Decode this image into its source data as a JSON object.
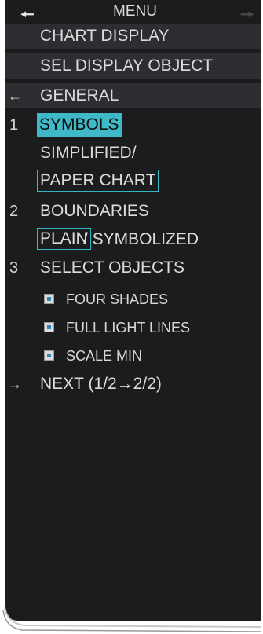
{
  "menu": {
    "title": "MENU",
    "back_icon": "left-arrow-icon",
    "forward_icon": "right-arrow-icon"
  },
  "submenus": {
    "chart_display": "CHART DISPLAY",
    "sel_display_object": "SEL DISPLAY OBJECT"
  },
  "back_row": {
    "icon": "left-arrow-icon",
    "label": "GENERAL"
  },
  "items": {
    "symbols": {
      "number": "1",
      "label": "SYMBOLS",
      "options": [
        "SIMPLIFIED/",
        "PAPER CHART"
      ]
    },
    "boundaries": {
      "number": "2",
      "label": "BOUNDARIES",
      "options": [
        "PLAIN",
        "/ SYMBOLIZED"
      ]
    },
    "select_objects": {
      "number": "3",
      "label": "SELECT OBJECTS",
      "checks": [
        "FOUR SHADES",
        "FULL LIGHT LINES",
        "SCALE MIN"
      ]
    }
  },
  "next_row": {
    "icon": "right-arrow-icon",
    "label": "NEXT (1/2→2/2)"
  },
  "colors": {
    "panel": "#1b1c1e",
    "accent": "#3fb8c8"
  }
}
